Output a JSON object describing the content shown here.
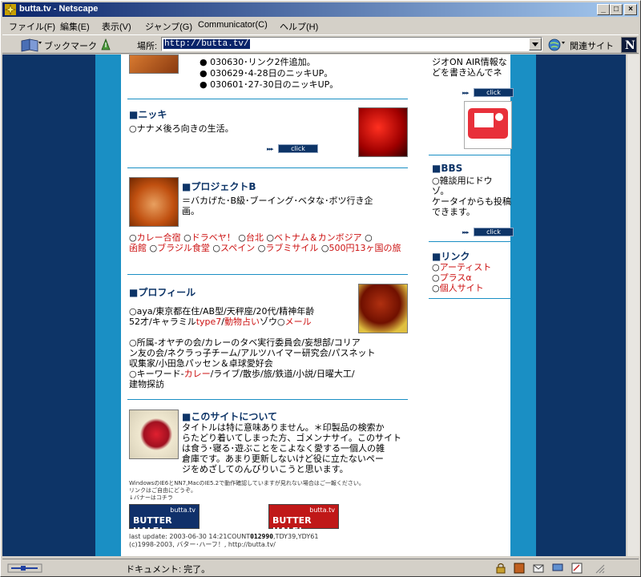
{
  "window": {
    "title": "butta.tv - Netscape"
  },
  "menu": [
    "ファイル(F)",
    "編集(E)",
    "表示(V)",
    "ジャンプ(G)",
    "Communicator(C)",
    "ヘルプ(H)"
  ],
  "location": {
    "bookmark_label": "ブックマーク",
    "location_label": "場所:",
    "url": "http://butta.tv/",
    "related_label": "関連サイト"
  },
  "status": {
    "text": "ドキュメント: 完了。"
  },
  "colors": {
    "navy": "#0d3467",
    "blue_stripe": "#1a8fc4",
    "link_red": "#cc1111"
  },
  "news": {
    "items": [
      "030630･リンク2件追加。",
      "030629･4-28日のニッキUP。",
      "030601･27-30日のニッキUP。"
    ]
  },
  "nikki": {
    "title": "ニッキ",
    "desc": "ナナメ後ろ向きの生活。"
  },
  "click_label": "click",
  "project": {
    "title": "プロジェクトB",
    "desc_line1": "＝バカげた･B級･ブーイング･ベタな･ボツ行き企",
    "desc_line2": "画。",
    "links": [
      "カレー合宿",
      "ドラベヤ！",
      "台北",
      "ベトナム＆カンボジア",
      "函館",
      "ブラジル食堂",
      "スペイン",
      "ラブミサイル",
      "500円13ヶ国の旅"
    ]
  },
  "profile": {
    "title": "プロフィール",
    "line1": "aya/東京都在住/AB型/天秤座/20代/精神年齢",
    "line2_prefix": "52才/キャラミル",
    "line2_link1": "type7",
    "line2_sep": "/",
    "line2_link2": "動物占い",
    "line2_mid": "ゾウ",
    "line2_link3": "メール",
    "aff_line1": "所属-オヤヂの会/カレーのタベ実行委員会/妄想部/コリア",
    "aff_line2": "ン友の会/ネクラっ子チーム/アルツハイマー研究会/パスネット",
    "aff_line3": "収集家/小田急パッセン＆卓球愛好会",
    "kw_prefix": "キーワード-",
    "kw_link": "カレー",
    "kw_rest": "/ライブ/散歩/旅/鉄道/小説/日曜大工/",
    "kw_line2": "建物探訪"
  },
  "about": {
    "title": "このサイトについて",
    "lines": [
      "タイトルは特に意味ありません。＊印製品の検索か",
      "らたどり着いてしまった方、ゴメンナサイ。このサイト",
      "は食う･寝る･遊ぶことをこよなく愛する一個人の雑",
      "倉庫です。あまり更新しないけど役に立たないペー",
      "ジをめざしてのんびりいこうと思います。"
    ]
  },
  "notes": {
    "line1": "WindowsのIE6とNN7,MacのIE5.2で動作確認していますが見れない場合はご一報ください。",
    "line2": "リンクはご自由にどうぞ。",
    "line3": "↓バナーはコチラ"
  },
  "banners": [
    {
      "top": "butta.tv",
      "text": "BUTTER HALF!"
    },
    {
      "top": "butta.tv",
      "text": "BUTTER HALF!"
    }
  ],
  "footer": {
    "update": "last update: 2003-06-30 14:21",
    "count_label": "COUNT",
    "count": "012990",
    "count_rest": ",TDY39,YDY61",
    "copyright": "(c)1998-2003, バター･ハーフ！, http://butta.tv/"
  },
  "sidebar": {
    "radio_line1": "ジオON AIR情報な",
    "radio_line2": "どを書き込んでネ",
    "bbs_title": "BBS",
    "bbs_line1": "雑談用にドウ",
    "bbs_line2": "ゾ。",
    "bbs_line3": "ケータイからも投稿",
    "bbs_line4": "できます。",
    "link_title": "リンク",
    "links": [
      "アーティスト",
      "プラスα",
      "個人サイト"
    ]
  }
}
